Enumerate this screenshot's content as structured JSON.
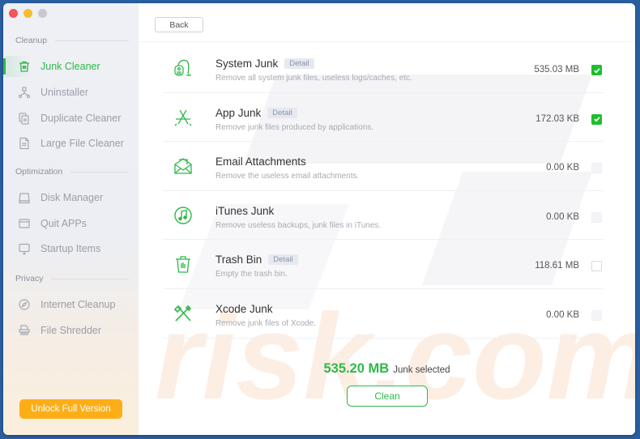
{
  "window": {
    "traffic_lights": [
      "close",
      "minimize",
      "maximize"
    ]
  },
  "sidebar": {
    "sections": [
      {
        "label": "Cleanup",
        "items": [
          {
            "label": "Junk Cleaner",
            "icon": "trash-icon",
            "active": true
          },
          {
            "label": "Uninstaller",
            "icon": "uninstaller-icon",
            "active": false
          },
          {
            "label": "Duplicate Cleaner",
            "icon": "duplicate-icon",
            "active": false
          },
          {
            "label": "Large File Cleaner",
            "icon": "large-file-icon",
            "active": false
          }
        ]
      },
      {
        "label": "Optimization",
        "items": [
          {
            "label": "Disk Manager",
            "icon": "disk-icon",
            "active": false
          },
          {
            "label": "Quit APPs",
            "icon": "window-icon",
            "active": false
          },
          {
            "label": "Startup Items",
            "icon": "monitor-icon",
            "active": false
          }
        ]
      },
      {
        "label": "Privacy",
        "items": [
          {
            "label": "Internet Cleanup",
            "icon": "compass-icon",
            "active": false
          },
          {
            "label": "File Shredder",
            "icon": "shredder-icon",
            "active": false
          }
        ]
      }
    ],
    "unlock_label": "Unlock Full Version"
  },
  "toolbar": {
    "back_label": "Back"
  },
  "junk_items": [
    {
      "title": "System Junk",
      "detail": "Detail",
      "description": "Remove all system junk files, useless logs/caches, etc.",
      "size": "535.03 MB",
      "checked": true,
      "disabled": false,
      "icon": "vacuum-icon"
    },
    {
      "title": "App Junk",
      "detail": "Detail",
      "description": "Remove junk files produced by applications.",
      "size": "172.03 KB",
      "checked": true,
      "disabled": false,
      "icon": "app-store-icon"
    },
    {
      "title": "Email Attachments",
      "detail": "",
      "description": "Remove the useless email attachments.",
      "size": "0.00 KB",
      "checked": false,
      "disabled": true,
      "icon": "mail-icon"
    },
    {
      "title": "iTunes Junk",
      "detail": "",
      "description": "Remove useless backups, junk files in iTunes.",
      "size": "0.00 KB",
      "checked": false,
      "disabled": true,
      "icon": "music-icon"
    },
    {
      "title": "Trash Bin",
      "detail": "Detail",
      "description": "Empty the trash bin.",
      "size": "118.61 MB",
      "checked": false,
      "disabled": false,
      "icon": "trash-icon"
    },
    {
      "title": "Xcode Junk",
      "detail": "",
      "description": "Remove junk files of Xcode.",
      "size": "0.00 KB",
      "checked": false,
      "disabled": true,
      "icon": "tools-icon"
    }
  ],
  "summary": {
    "amount": "535.20 MB",
    "label": "Junk selected"
  },
  "clean_label": "Clean",
  "colors": {
    "accent_green": "#2fb84a",
    "checkbox_green": "#1dbf2c",
    "unlock_orange": "#fdae17",
    "desktop_blue": "#2a5f9f"
  }
}
